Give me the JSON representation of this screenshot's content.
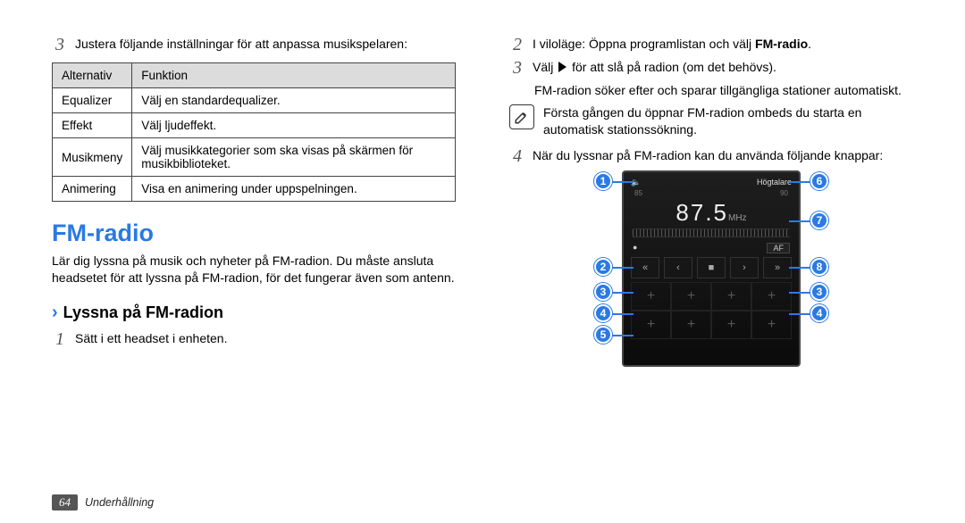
{
  "left": {
    "step3": {
      "num": "3",
      "text": "Justera följande inställningar för att anpassa musikspelaren:"
    },
    "table": {
      "head": {
        "col1": "Alternativ",
        "col2": "Funktion"
      },
      "rows": [
        {
          "c1": "Equalizer",
          "c2": "Välj en standardequalizer."
        },
        {
          "c1": "Effekt",
          "c2": "Välj ljudeffekt."
        },
        {
          "c1": "Musikmeny",
          "c2": "Välj musikkategorier som ska visas på skärmen för musikbiblioteket."
        },
        {
          "c1": "Animering",
          "c2": "Visa en animering under uppspelningen."
        }
      ]
    },
    "section_title": "FM-radio",
    "intro": "Lär dig lyssna på musik och nyheter på FM-radion. Du måste ansluta headsetet för att lyssna på FM-radion, för det fungerar även som antenn.",
    "sub_title": "Lyssna på FM-radion",
    "step1": {
      "num": "1",
      "text": "Sätt i ett headset i enheten."
    }
  },
  "right": {
    "step2": {
      "num": "2",
      "pre": "I viloläge: Öppna programlistan och välj ",
      "bold": "FM-radio",
      "post": "."
    },
    "step3": {
      "num": "3",
      "pre": "Välj ",
      "post": " för att slå på radion (om det behövs)."
    },
    "fm_search": "FM-radion söker efter och sparar tillgängliga stationer automatiskt.",
    "note": "Första gången du öppnar FM-radion ombeds du starta en automatisk stationssökning.",
    "step4": {
      "num": "4",
      "text": "När du lyssnar på FM-radion kan du använda följande knappar:"
    }
  },
  "radio": {
    "speaker_icon": "🔈",
    "headphone_label": "Högtalare",
    "band_left": "85",
    "band_right": "90",
    "freq": "87.5",
    "freq_unit": "MHz",
    "rec": "●",
    "af": "AF",
    "scan_prev": "«",
    "prev": "‹",
    "stop": "■",
    "next": "›",
    "scan_next": "»",
    "plus": "+"
  },
  "callouts": {
    "n1": "1",
    "n2": "2",
    "n3": "3",
    "n4": "4",
    "n5": "5",
    "n6": "6",
    "n7": "7",
    "n8": "8"
  },
  "footer": {
    "page": "64",
    "section": "Underhållning"
  }
}
